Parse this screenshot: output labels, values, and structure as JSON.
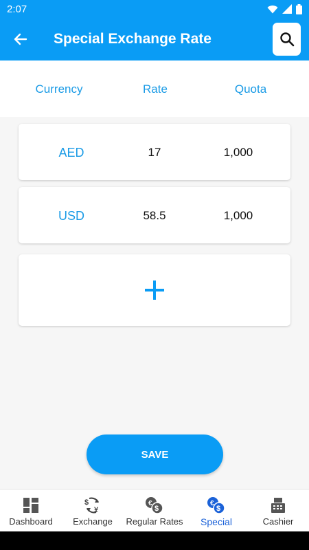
{
  "status": {
    "time": "2:07"
  },
  "appbar": {
    "title": "Special Exchange Rate"
  },
  "columns": {
    "currency": "Currency",
    "rate": "Rate",
    "quota": "Quota"
  },
  "rows": [
    {
      "currency": "AED",
      "rate": "17",
      "quota": "1,000"
    },
    {
      "currency": "USD",
      "rate": "58.5",
      "quota": "1,000"
    }
  ],
  "add_icon": "plus-icon",
  "save_label": "SAVE",
  "nav": [
    {
      "label": "Dashboard",
      "icon": "dashboard-icon"
    },
    {
      "label": "Exchange",
      "icon": "exchange-icon"
    },
    {
      "label": "Regular Rates",
      "icon": "regular-rates-icon"
    },
    {
      "label": "Special",
      "icon": "special-icon",
      "active": true
    },
    {
      "label": "Cashier",
      "icon": "cashier-icon"
    }
  ],
  "colors": {
    "primary": "#0a9cf5",
    "accent_text": "#1a9be6",
    "active_nav": "#1b62d8"
  }
}
